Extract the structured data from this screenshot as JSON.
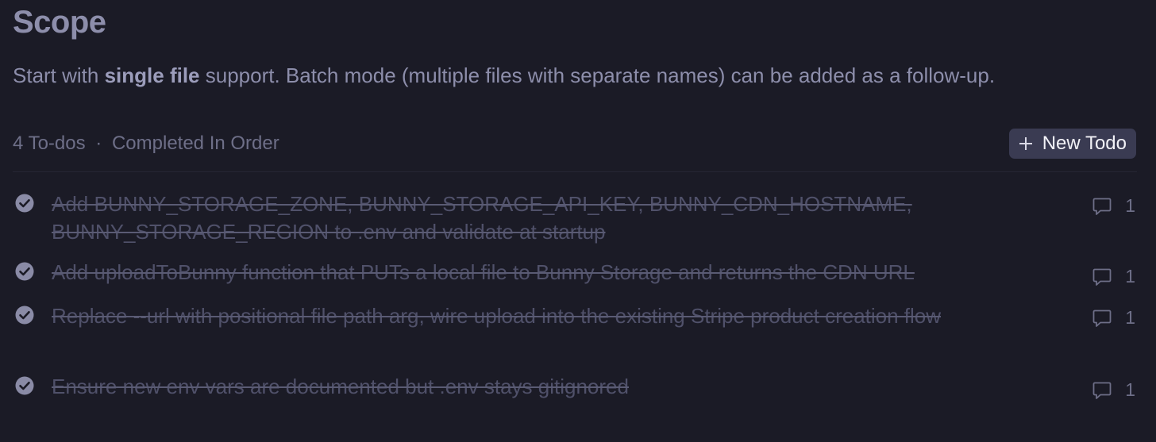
{
  "section": {
    "title": "Scope",
    "description": {
      "prefix": "Start with ",
      "emphasis": "single file",
      "suffix": " support. Batch mode (multiple files with separate names) can be added as a follow-up."
    }
  },
  "todos_header": {
    "count_label": "4 To-dos",
    "separator": "·",
    "mode_label": "Completed In Order",
    "new_todo_label": "New Todo"
  },
  "todos": [
    {
      "text": "Add BUNNY_STORAGE_ZONE, BUNNY_STORAGE_API_KEY, BUNNY_CDN_HOSTNAME, BUNNY_STORAGE_REGION to .env and validate at startup",
      "completed": true,
      "comment_count": "1"
    },
    {
      "text": "Add uploadToBunny function that PUTs a local file to Bunny Storage and returns the CDN URL",
      "completed": true,
      "comment_count": "1"
    },
    {
      "text": "Replace --url with positional file path arg, wire upload into the existing Stripe product creation flow",
      "completed": true,
      "comment_count": "1"
    },
    {
      "text": "Ensure new env vars are documented but .env stays gitignored",
      "completed": true,
      "comment_count": "1"
    }
  ],
  "icons": {
    "check": "check-circle-icon",
    "comment": "comment-bubble-icon",
    "plus": "plus-icon"
  },
  "colors": {
    "background": "#1b1b26",
    "heading": "#8d8eab",
    "muted": "#6e6f88",
    "completed_text": "#50516a",
    "button_bg": "#3a3b52"
  }
}
